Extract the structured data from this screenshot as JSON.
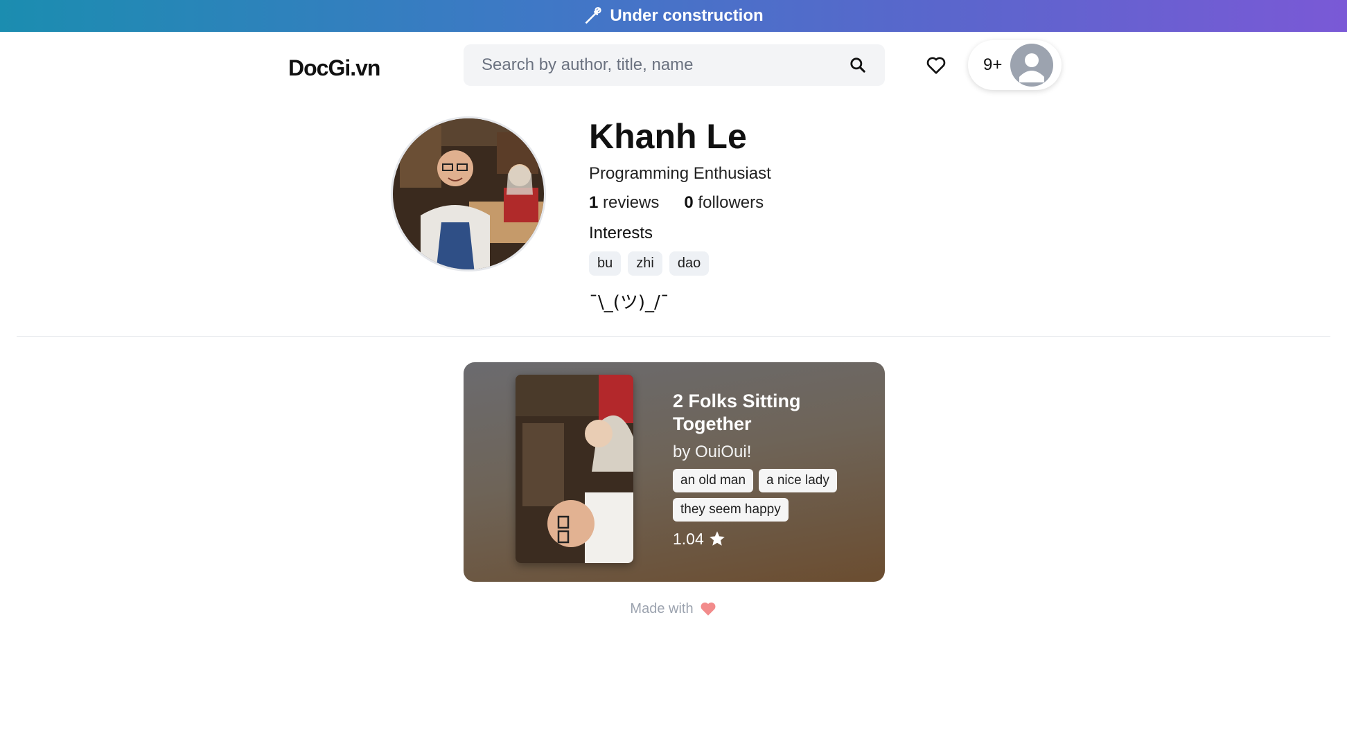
{
  "banner": {
    "text": "Under construction",
    "icon": "wrench-icon"
  },
  "header": {
    "logo": "DocGi.vn",
    "search": {
      "placeholder": "Search by author, title, name",
      "icon": "search-icon"
    },
    "favorites_icon": "heart-outline-icon",
    "notifications_count": "9+",
    "avatar_icon": "user-icon"
  },
  "profile": {
    "name": "Khanh Le",
    "title": "Programming Enthusiast",
    "reviews_count": "1",
    "reviews_label": "reviews",
    "followers_count": "0",
    "followers_label": "followers",
    "interests_label": "Interests",
    "interests": [
      "bu",
      "zhi",
      "dao"
    ],
    "bio": "¯\\_(ツ)_/¯"
  },
  "review_card": {
    "title": "2 Folks Sitting Together",
    "author": "by OuiOui!",
    "tags": [
      "an old man",
      "a nice lady",
      "they seem happy"
    ],
    "rating": "1.04",
    "rating_icon": "star-icon"
  },
  "footer": {
    "text": "Made with",
    "icon": "heart-icon"
  },
  "colors": {
    "banner_start": "#1b8db0",
    "banner_end": "#7a59d6",
    "card_top": "#6b6b6f",
    "card_bottom": "#6b4d30",
    "chip_bg": "#eef1f5",
    "heart": "#f28b8b"
  }
}
